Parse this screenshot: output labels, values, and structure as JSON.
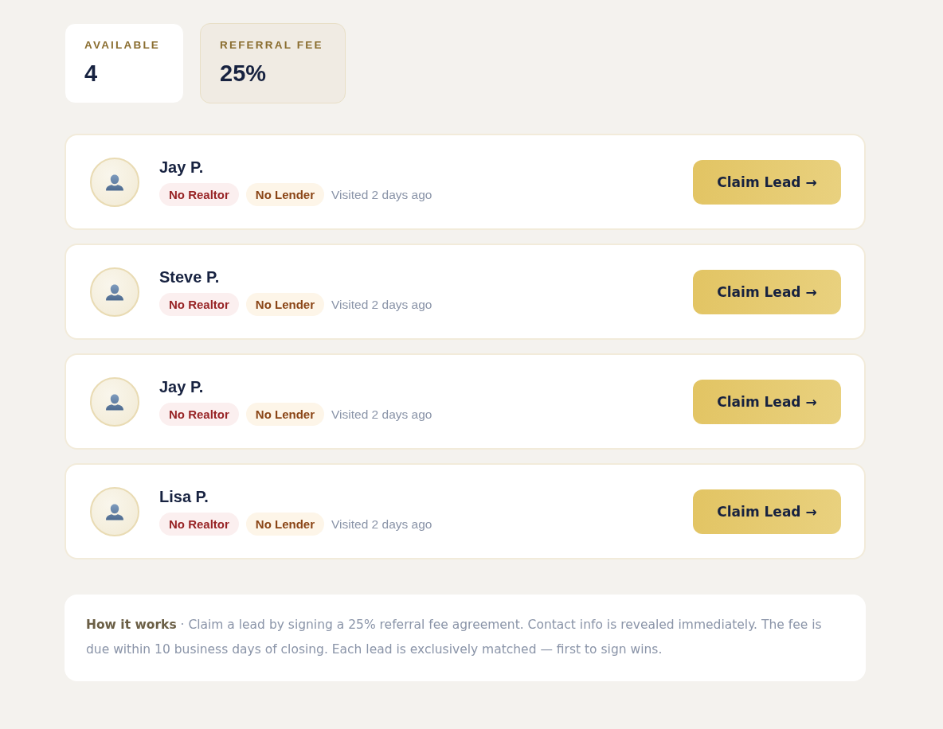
{
  "stats": [
    {
      "label": "AVAILABLE",
      "value": "4",
      "kind": "plain"
    },
    {
      "label": "REFERRAL FEE",
      "value": "25%",
      "kind": "highlight"
    }
  ],
  "leads": [
    {
      "name": "Jay P.",
      "tags": [
        {
          "label": "No Realtor",
          "kind": "realtor"
        },
        {
          "label": "No Lender",
          "kind": "lender"
        }
      ],
      "visited": "Visited 2 days ago",
      "action": "Claim Lead →"
    },
    {
      "name": "Steve P.",
      "tags": [
        {
          "label": "No Realtor",
          "kind": "realtor"
        },
        {
          "label": "No Lender",
          "kind": "lender"
        }
      ],
      "visited": "Visited 2 days ago",
      "action": "Claim Lead →"
    },
    {
      "name": "Jay P.",
      "tags": [
        {
          "label": "No Realtor",
          "kind": "realtor"
        },
        {
          "label": "No Lender",
          "kind": "lender"
        }
      ],
      "visited": "Visited 2 days ago",
      "action": "Claim Lead →"
    },
    {
      "name": "Lisa P.",
      "tags": [
        {
          "label": "No Realtor",
          "kind": "realtor"
        },
        {
          "label": "No Lender",
          "kind": "lender"
        }
      ],
      "visited": "Visited 2 days ago",
      "action": "Claim Lead →"
    }
  ],
  "note": {
    "text": "**How it works** · Claim a lead by signing a 25% referral fee agreement. Contact info is revealed immediately. The fee is due within 10 business days of closing. Each lead is exclusively matched — first to sign wins."
  }
}
